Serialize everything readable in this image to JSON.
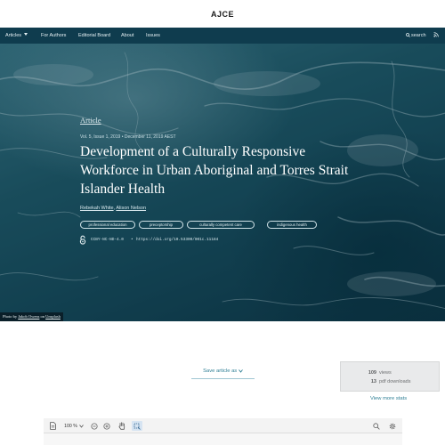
{
  "site": {
    "title": "AJCE"
  },
  "nav": {
    "items": [
      {
        "label": "Articles",
        "has_dropdown": true
      },
      {
        "label": "For Authors"
      },
      {
        "label": "Editorial Board"
      },
      {
        "label": "About"
      },
      {
        "label": "Issues"
      }
    ],
    "search_label": "search",
    "rss_icon": "rss-icon"
  },
  "article": {
    "type": "Article",
    "meta": "Vol. 5, Issue 1, 2019 • December 11, 2019 AEST",
    "title": "Development of a Culturally Responsive Workforce in Urban Aboriginal and Torres Strait Islander Health",
    "authors": [
      "Rebekah White",
      "Alison Nelson"
    ],
    "author_separator": ", ",
    "keywords": [
      "professional education",
      "preceptorship",
      "culturally competent care",
      "indigenous health"
    ],
    "license": "CCBY-NC-ND-4.0",
    "separator": "•",
    "doi": "https://doi.org/10.53300/001c.11184",
    "open_access_icon": "open-access-icon"
  },
  "photo_credit": {
    "prefix": "Photo by",
    "author": "Jakob Owens",
    "middle": "on",
    "source": "Unsplash"
  },
  "save_article": {
    "label": "Save article as",
    "icon": "chevron-down-icon"
  },
  "stats": {
    "views_count": "109",
    "views_label": "views",
    "pdf_count": "13",
    "pdf_label": "pdf downloads",
    "more_link": "View more stats"
  },
  "pdf_viewer": {
    "zoom": "100 %",
    "icons": [
      "document-icon",
      "zoom-out-icon",
      "zoom-in-icon",
      "hand-tool-icon",
      "select-tool-icon",
      "search-icon",
      "settings-gear-icon"
    ]
  },
  "colors": {
    "nav_bg": "#0f3c4e",
    "link": "#2f7f95",
    "stats_bg": "#e9eaeb"
  }
}
